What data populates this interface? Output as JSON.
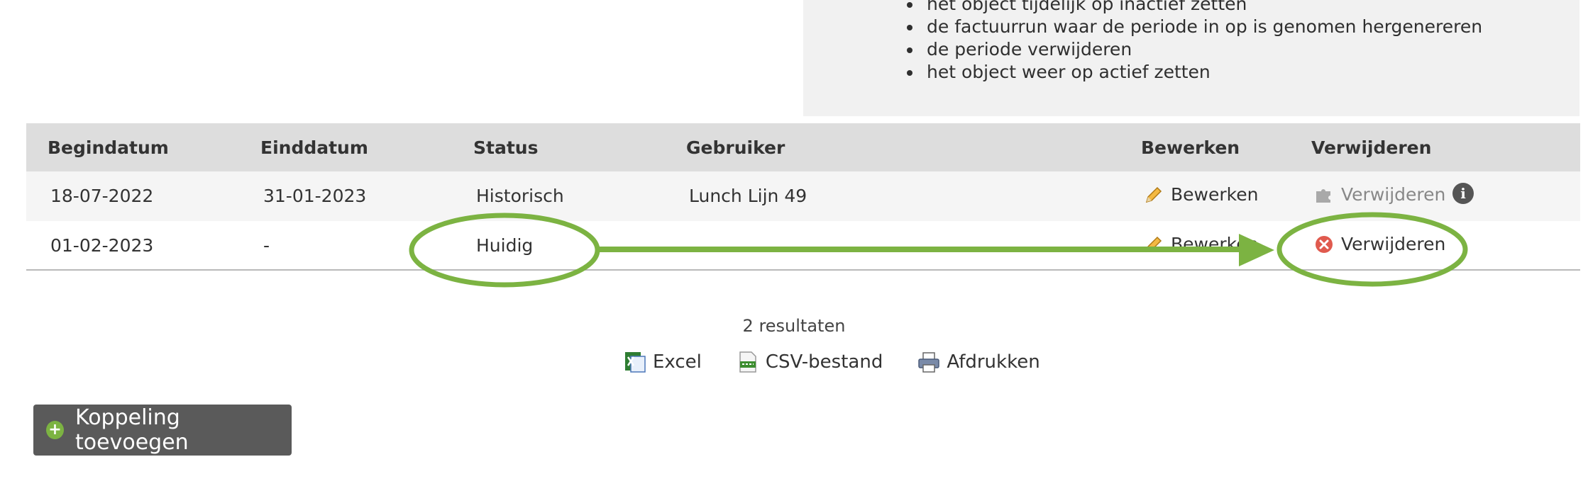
{
  "info": {
    "items": [
      "het object tijdelijk op inactief zetten",
      "de factuurrun waar de periode in op is genomen hergenereren",
      "de periode verwijderen",
      "het object weer op actief zetten"
    ]
  },
  "table": {
    "headers": {
      "begindatum": "Begindatum",
      "einddatum": "Einddatum",
      "status": "Status",
      "gebruiker": "Gebruiker",
      "bewerken": "Bewerken",
      "verwijderen": "Verwijderen"
    },
    "rows": [
      {
        "begindatum": "18-07-2022",
        "einddatum": "31-01-2023",
        "status": "Historisch",
        "gebruiker": "Lunch Lijn 49",
        "bewerken": "Bewerken",
        "verwijderen": "Verwijderen",
        "verwijderen_enabled": false
      },
      {
        "begindatum": "01-02-2023",
        "einddatum": "-",
        "status": "Huidig",
        "gebruiker": "",
        "bewerken": "Bewerken",
        "verwijderen": "Verwijderen",
        "verwijderen_enabled": true
      }
    ]
  },
  "results": "2 resultaten",
  "exports": {
    "excel": "Excel",
    "csv": "CSV-bestand",
    "print": "Afdrukken"
  },
  "add_button": "Koppeling toevoegen",
  "colors": {
    "annotation_green": "#7cb342",
    "header_bg": "#dddddd",
    "button_bg": "#5a5a5a",
    "delete_red": "#e05a4e"
  },
  "icons": {
    "edit": "pencil-icon",
    "delete_disabled": "puzzle-icon",
    "delete": "delete-x-icon",
    "info": "info-icon",
    "excel": "excel-icon",
    "csv": "csv-icon",
    "print": "printer-icon",
    "add": "plus-circle-icon"
  }
}
